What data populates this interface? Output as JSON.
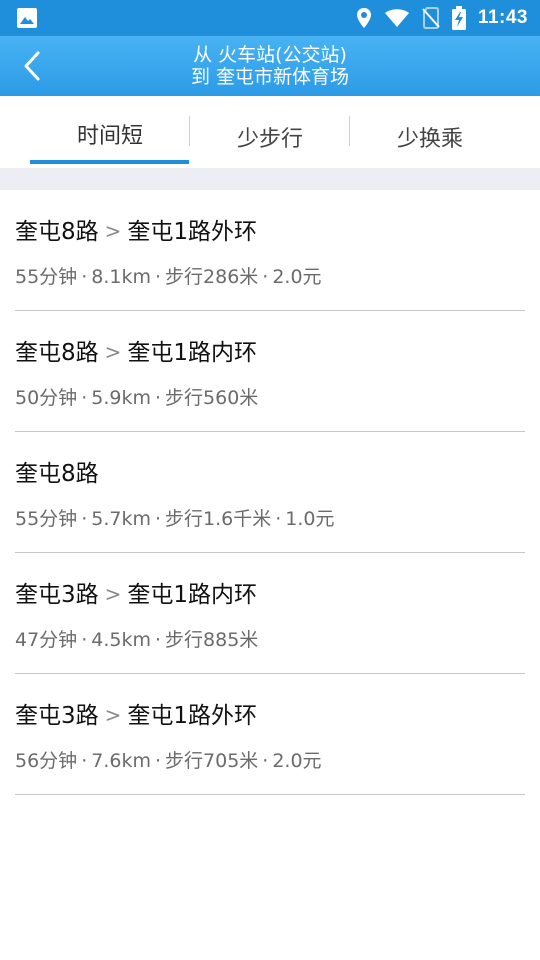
{
  "status_bar": {
    "time": "11:43",
    "icons": [
      "image-icon",
      "location-icon",
      "wifi-icon",
      "no-sim-icon",
      "battery-charging-icon"
    ]
  },
  "header": {
    "from_prefix": "从",
    "from": "火车站(公交站)",
    "to_prefix": "到",
    "to": "奎屯市新体育场",
    "back_icon": "chevron-left-icon"
  },
  "tabs": [
    {
      "label": "时间短",
      "active": true
    },
    {
      "label": "少步行",
      "active": false
    },
    {
      "label": "少换乘",
      "active": false
    }
  ],
  "colors": {
    "status_bar": "#1f8fdc",
    "header": "#3aa6ee",
    "accent": "#1f8fdc",
    "band": "#eceef4"
  },
  "routes": [
    {
      "lines": [
        "奎屯8路",
        "奎屯1路外环"
      ],
      "separator": ">",
      "duration": "55分钟",
      "distance": "8.1km",
      "walk": "步行286米",
      "fare": "2.0元"
    },
    {
      "lines": [
        "奎屯8路",
        "奎屯1路内环"
      ],
      "separator": ">",
      "duration": "50分钟",
      "distance": "5.9km",
      "walk": "步行560米",
      "fare": ""
    },
    {
      "lines": [
        "奎屯8路"
      ],
      "separator": "",
      "duration": "55分钟",
      "distance": "5.7km",
      "walk": "步行1.6千米",
      "fare": "1.0元"
    },
    {
      "lines": [
        "奎屯3路",
        "奎屯1路内环"
      ],
      "separator": ">",
      "duration": "47分钟",
      "distance": "4.5km",
      "walk": "步行885米",
      "fare": ""
    },
    {
      "lines": [
        "奎屯3路",
        "奎屯1路外环"
      ],
      "separator": ">",
      "duration": "56分钟",
      "distance": "7.6km",
      "walk": "步行705米",
      "fare": "2.0元"
    }
  ]
}
